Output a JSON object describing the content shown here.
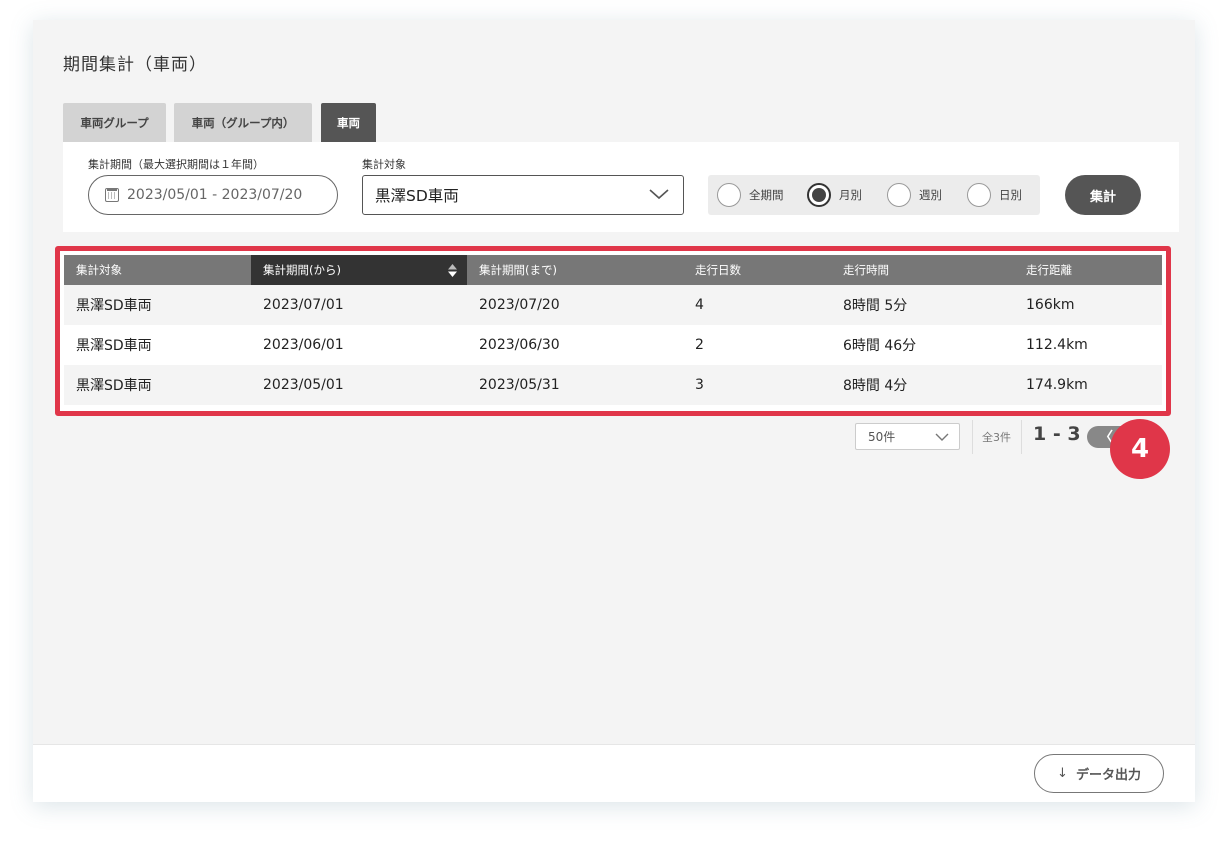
{
  "page": {
    "title": "期間集計（車両）"
  },
  "tabs": [
    {
      "label": "車両グループ",
      "active": false
    },
    {
      "label": "車両（グループ内）",
      "active": false
    },
    {
      "label": "車両",
      "active": true
    }
  ],
  "filters": {
    "period_label": "集計期間（最大選択期間は１年間）",
    "period_value": "2023/05/01 - 2023/07/20",
    "target_label": "集計対象",
    "target_value": "黒澤SD車両",
    "radios": [
      {
        "label": "全期間",
        "selected": false
      },
      {
        "label": "月別",
        "selected": true
      },
      {
        "label": "週別",
        "selected": false
      },
      {
        "label": "日別",
        "selected": false
      }
    ],
    "submit_label": "集計"
  },
  "table": {
    "headers": [
      "集計対象",
      "集計期間(から)",
      "集計期間(まで)",
      "走行日数",
      "走行時間",
      "走行距離"
    ],
    "sorted_column": 1,
    "rows": [
      [
        "黒澤SD車両",
        "2023/07/01",
        "2023/07/20",
        "4",
        "8時間 5分",
        "166km"
      ],
      [
        "黒澤SD車両",
        "2023/06/01",
        "2023/06/30",
        "2",
        "6時間 46分",
        "112.4km"
      ],
      [
        "黒澤SD車両",
        "2023/05/01",
        "2023/05/31",
        "3",
        "8時間 4分",
        "174.9km"
      ]
    ]
  },
  "pagination": {
    "per_page": "50件",
    "total": "全3件",
    "range": "1 - 3",
    "prev_label": "〈"
  },
  "annotation": {
    "badge_number": "4",
    "color": "#e03649"
  },
  "footer": {
    "export_label": "データ出力",
    "export_icon": "download-arrow-icon"
  },
  "colors": {
    "accent_dark": "#555555",
    "header_gray": "#777777",
    "sorted_header": "#333333",
    "highlight": "#e03649"
  }
}
